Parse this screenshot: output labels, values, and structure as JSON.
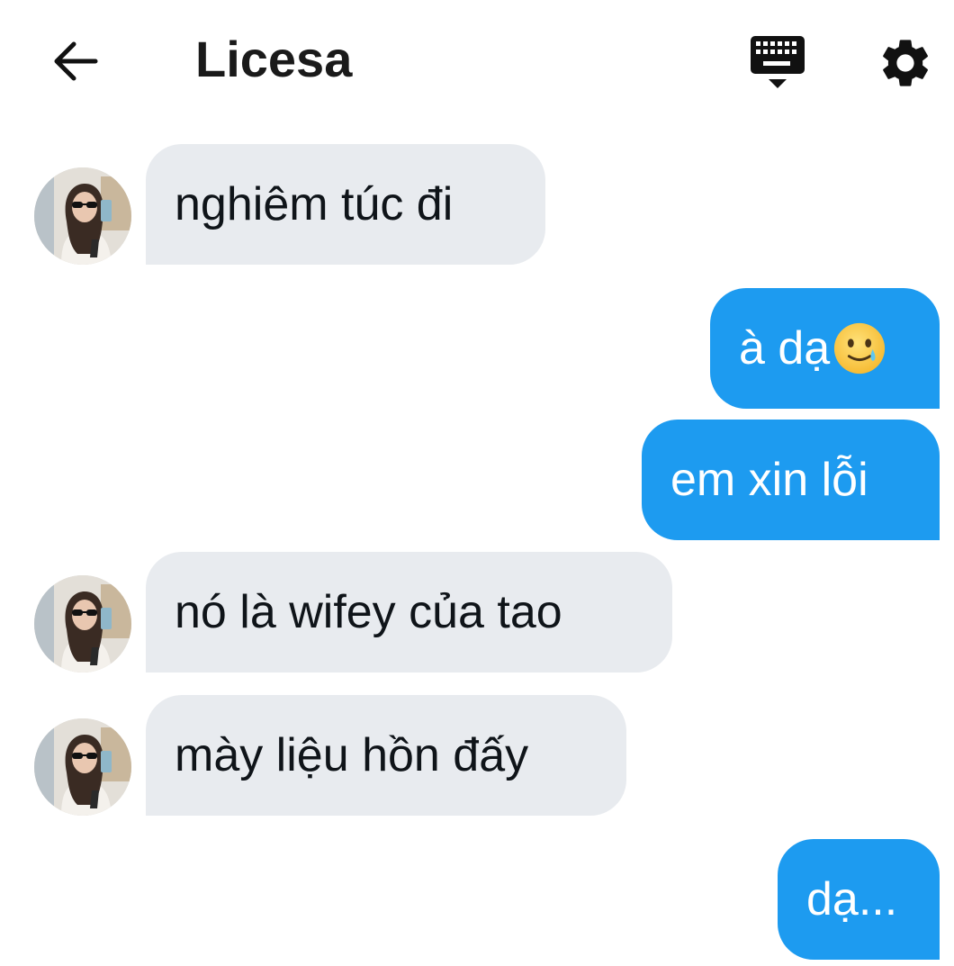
{
  "header": {
    "title": "Licesa"
  },
  "icons": {
    "back": "arrow-left-icon",
    "keyboard": "keyboard-icon",
    "settings": "gear-icon",
    "emoji": "face-holding-back-tears-emoji"
  },
  "colors": {
    "incoming_bubble": "#e8ebef",
    "outgoing_bubble": "#1d9bf0",
    "outgoing_text": "#ffffff",
    "incoming_text": "#0f1419"
  },
  "messages": [
    {
      "direction": "in",
      "text": "nghiêm túc đi"
    },
    {
      "direction": "out",
      "text": "à dạ",
      "emoji": "🥲"
    },
    {
      "direction": "out",
      "text": "em xin lỗi"
    },
    {
      "direction": "in",
      "text": "nó là wifey của tao"
    },
    {
      "direction": "in",
      "text": "mày liệu hồn đấy"
    },
    {
      "direction": "out",
      "text": "dạ..."
    }
  ]
}
